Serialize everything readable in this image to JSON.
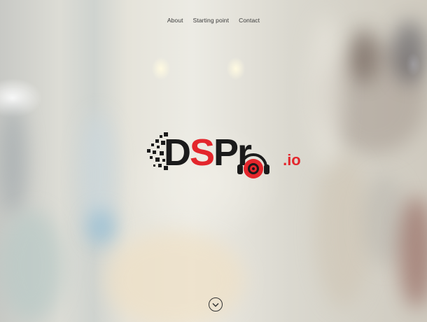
{
  "nav": {
    "items": [
      {
        "label": "About"
      },
      {
        "label": "Starting point"
      },
      {
        "label": "Contact"
      }
    ]
  },
  "logo": {
    "letter_d": "D",
    "letter_s": "S",
    "letters_pr": "Pr",
    "suffix": ".io",
    "colors": {
      "dark": "#1b1b1b",
      "accent": "#e3262c"
    }
  },
  "scroll_button": {
    "icon": "chevron-down-icon"
  }
}
